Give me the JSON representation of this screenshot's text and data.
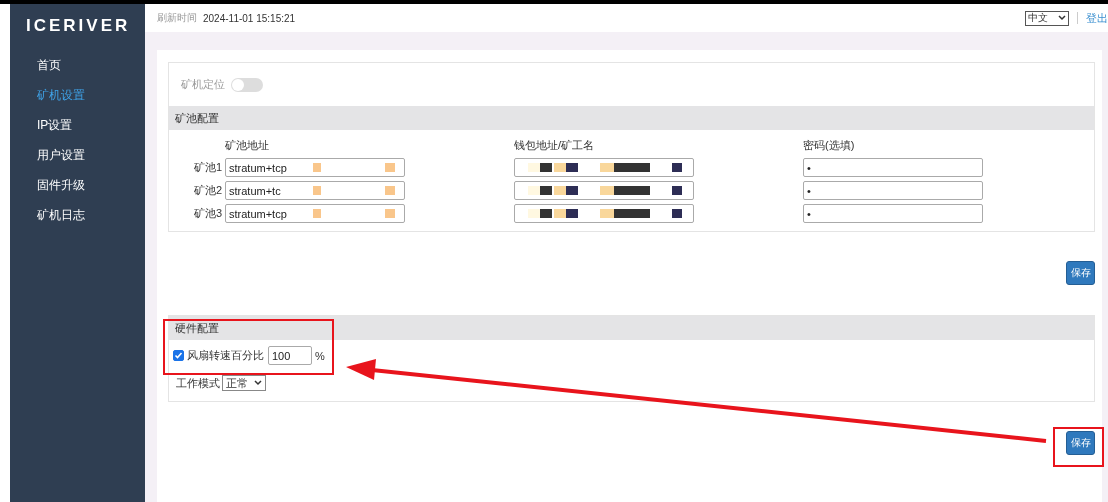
{
  "logo": "ICERIVER",
  "sidebar": {
    "items": [
      {
        "label": "首页",
        "selected": false
      },
      {
        "label": "矿机设置",
        "selected": true
      },
      {
        "label": "IP设置",
        "selected": false
      },
      {
        "label": "用户设置",
        "selected": false
      },
      {
        "label": "固件升级",
        "selected": false
      },
      {
        "label": "矿机日志",
        "selected": false
      }
    ]
  },
  "header": {
    "refresh_label": "刷新时间",
    "refresh_time": "2024-11-01 15:15:21",
    "language": "中文",
    "logout": "登出"
  },
  "locate": {
    "label": "矿机定位",
    "on": false
  },
  "pool_config": {
    "title": "矿池配置",
    "columns": [
      "矿池地址",
      "钱包地址/矿工名",
      "密码(选填)"
    ],
    "pools": [
      {
        "label": "矿池1",
        "address": "stratum+tcp",
        "password": "•"
      },
      {
        "label": "矿池2",
        "address": "stratum+tc",
        "password": "•"
      },
      {
        "label": "矿池3",
        "address": "stratum+tcp",
        "password": "•"
      }
    ],
    "save": "保存"
  },
  "hardware_config": {
    "title": "硬件配置",
    "fan": {
      "label": "风扇转速百分比",
      "checked": true,
      "value": "100",
      "unit": "%"
    },
    "work_mode": {
      "label": "工作模式",
      "value": "正常"
    }
  },
  "save": "保存"
}
